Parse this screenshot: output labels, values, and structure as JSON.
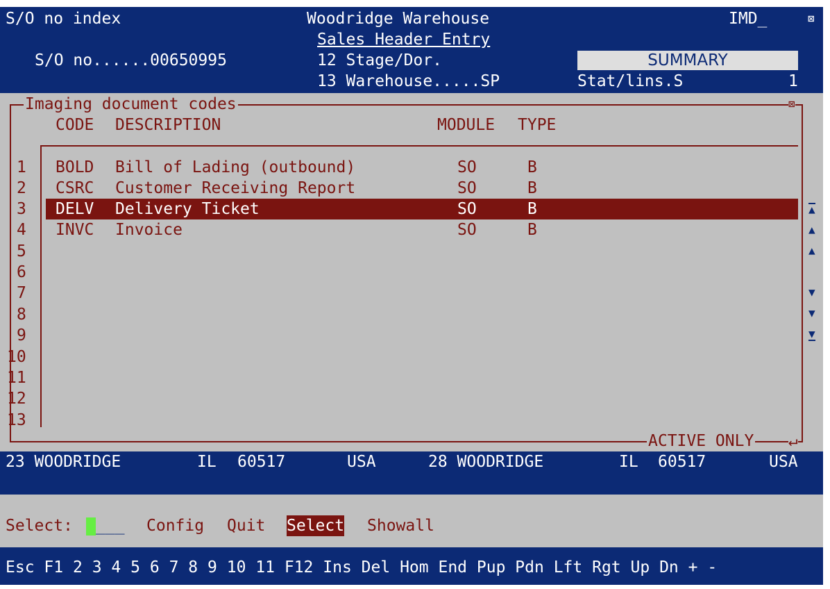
{
  "header": {
    "left_title": "S/O no index",
    "center_title": "Woodridge Warehouse",
    "subtitle": "Sales Header Entry",
    "right_title": "IMD_",
    "close_glyph": "⊠",
    "so_no": "S/O no......00650995",
    "stage": "12 Stage/Dor.",
    "warehouse": "13 Warehouse.....SP",
    "summary": "SUMMARY",
    "stat": "Stat/lins.S",
    "stat_count": "1"
  },
  "dialog": {
    "title": "Imaging document codes",
    "close_glyph": "⊠",
    "columns": {
      "code": "CODE",
      "description": "DESCRIPTION",
      "module": "MODULE",
      "type": "TYPE"
    },
    "line_numbers": [
      "1",
      "2",
      "3",
      "4",
      "5",
      "6",
      "7",
      "8",
      "9",
      "10",
      "11",
      "12",
      "13"
    ],
    "rows": [
      {
        "code": "BOLD",
        "description": "Bill of Lading (outbound)",
        "module": "SO",
        "type": "B"
      },
      {
        "code": "CSRC",
        "description": "Customer Receiving Report",
        "module": "SO",
        "type": "B"
      },
      {
        "code": "DELV",
        "description": "Delivery Ticket",
        "module": "SO",
        "type": "B"
      },
      {
        "code": "INVC",
        "description": "Invoice",
        "module": "SO",
        "type": "B"
      }
    ],
    "footer_label": "ACTIVE ONLY",
    "enter_glyph": "↵"
  },
  "address": {
    "left_city": "23 WOODRIDGE",
    "left_state": "IL",
    "left_zip": "60517",
    "left_country": "USA",
    "right_city": "28 WOODRIDGE",
    "right_state": "IL",
    "right_zip": "60517",
    "right_country": "USA"
  },
  "command": {
    "prompt": "Select:",
    "input_tail": "___",
    "config": "Config",
    "quit": "Quit",
    "select": "Select",
    "showall": "Showall"
  },
  "fkeys": [
    "Esc",
    "F1",
    "2",
    "3",
    "4",
    "5",
    "6",
    "7",
    "8",
    "9",
    "10",
    "11",
    "F12",
    "Ins",
    "Del",
    "Hom",
    "End",
    "Pup",
    "Pdn",
    "Lft",
    "Rgt",
    "Up",
    "Dn",
    "+",
    "-"
  ],
  "scroll_icons": [
    "▲",
    "▲",
    "▲",
    "▼",
    "▼",
    "▼"
  ],
  "colors": {
    "navy": "#0c2a75",
    "maroon": "#7a1410",
    "gray": "#c0c0c0",
    "cursor": "#66ee44"
  }
}
